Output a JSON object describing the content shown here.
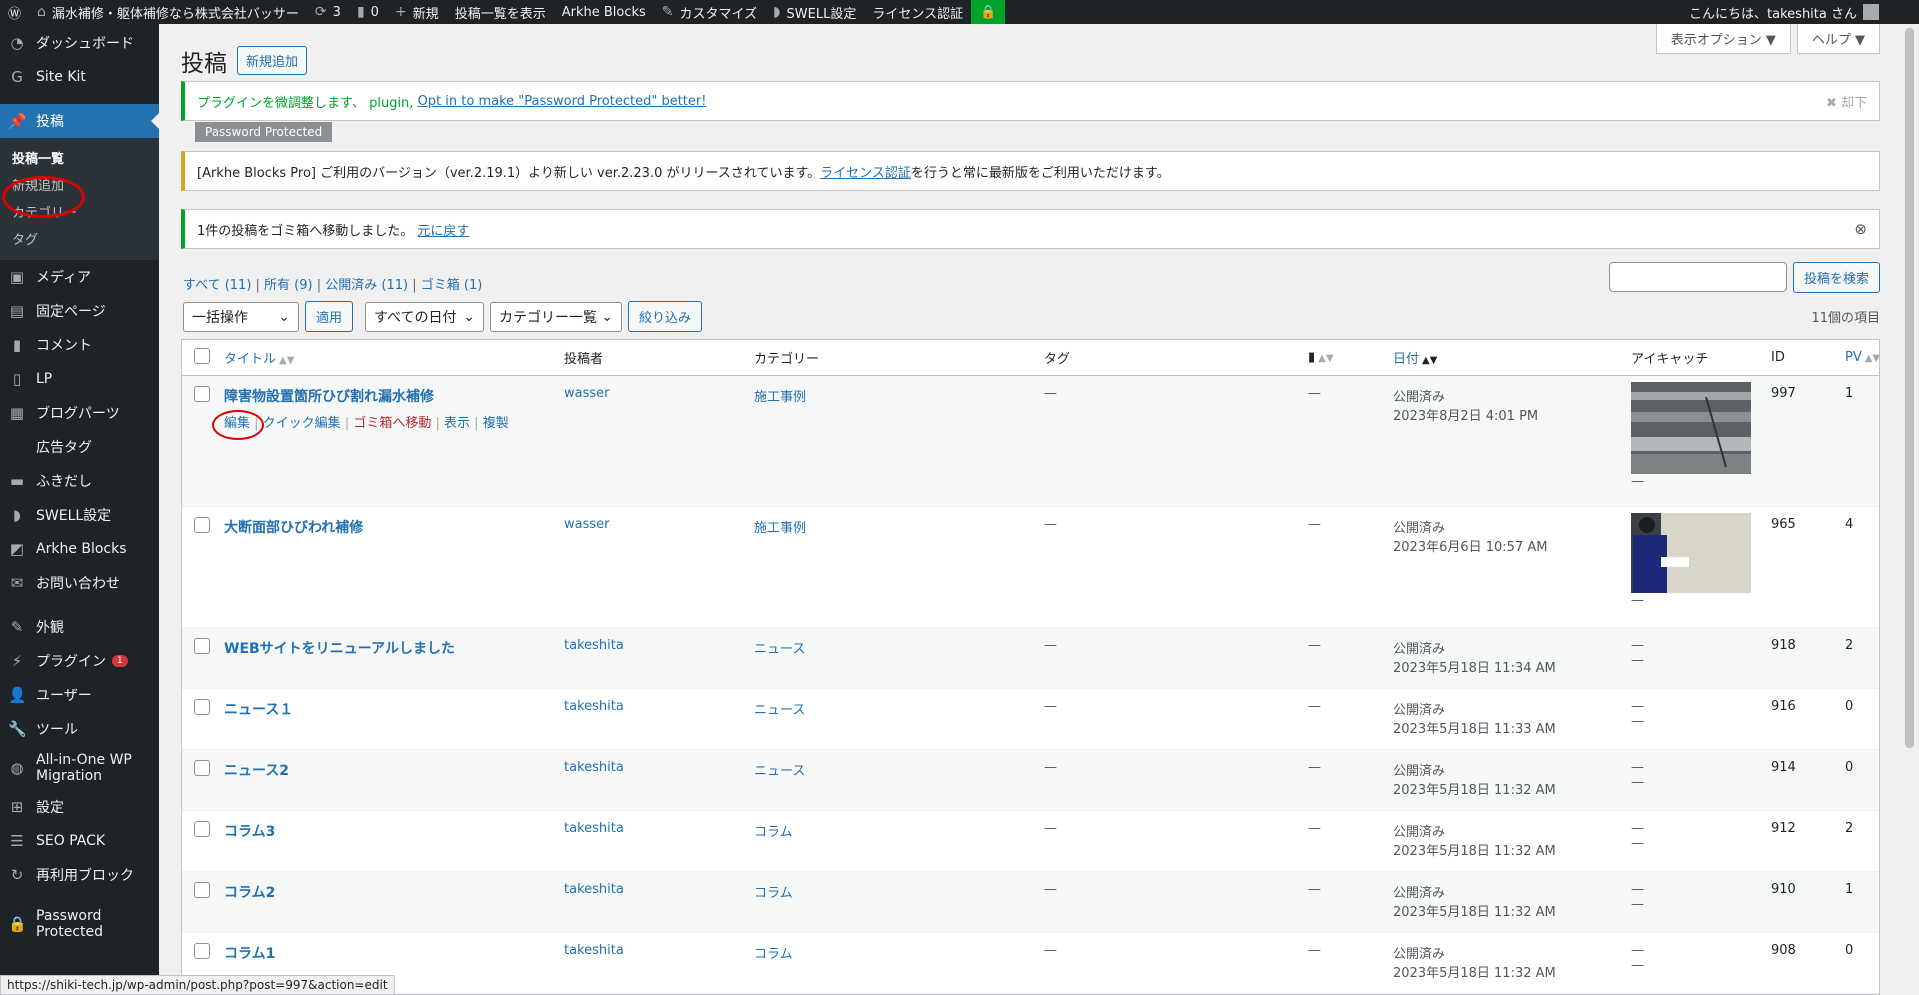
{
  "adminbar": {
    "site_name": "漏水補修・躯体補修なら株式会社バッサー",
    "updates": "3",
    "comments": "0",
    "new": "新規",
    "view_posts": "投稿一覧を表示",
    "arkhe": "Arkhe Blocks",
    "customize": "カスタマイズ",
    "swell": "SWELL設定",
    "license": "ライセンス認証",
    "greeting": "こんにちは、takeshita さん"
  },
  "sidebar": {
    "items": [
      {
        "label": "ダッシュボード"
      },
      {
        "label": "Site Kit"
      },
      {
        "label": "投稿"
      },
      {
        "label": "メディア"
      },
      {
        "label": "固定ページ"
      },
      {
        "label": "コメント"
      },
      {
        "label": "LP"
      },
      {
        "label": "ブログパーツ"
      },
      {
        "label": "広告タグ"
      },
      {
        "label": "ふきだし"
      },
      {
        "label": "SWELL設定"
      },
      {
        "label": "Arkhe Blocks"
      },
      {
        "label": "お問い合わせ"
      },
      {
        "label": "外観"
      },
      {
        "label": "プラグイン"
      },
      {
        "label": "ユーザー"
      },
      {
        "label": "ツール"
      },
      {
        "label": "All-in-One WP Migration"
      },
      {
        "label": "設定"
      },
      {
        "label": "SEO PACK"
      },
      {
        "label": "再利用ブロック"
      },
      {
        "label": "Password Protected"
      }
    ],
    "submenu": [
      "投稿一覧",
      "新規追加",
      "カテゴリー",
      "タグ"
    ],
    "plugin_badge": "1"
  },
  "screen_meta": {
    "options": "表示オプション ▼",
    "help": "ヘルプ ▼"
  },
  "page": {
    "title": "投稿",
    "add_new": "新規追加"
  },
  "notices": {
    "pp_text": "プラグインを微調整します、 plugin,",
    "pp_link": "Opt in to make \"Password Protected\" better!",
    "pp_dismiss": "✖ 却下",
    "pp_tag": "Password Protected",
    "arkhe_text1": "[Arkhe Blocks Pro] ご利用のバージョン（ver.2.19.1）より新しい ver.2.23.0 がリリースされています。",
    "arkhe_link": "ライセンス認証",
    "arkhe_text2": "を行うと常に最新版をご利用いただけます。",
    "trash_text": "1件の投稿をゴミ箱へ移動しました。",
    "trash_link": "元に戻す"
  },
  "filters": {
    "all": "すべて (11)",
    "mine": "所有 (9)",
    "published": "公開済み (11)",
    "trash": "ゴミ箱 (1)",
    "bulk": "一括操作",
    "apply": "適用",
    "dates": "すべての日付",
    "categories": "カテゴリー一覧",
    "filter": "絞り込み",
    "search_btn": "投稿を検索",
    "count": "11個の項目"
  },
  "table": {
    "headers": {
      "title": "タイトル",
      "author": "投稿者",
      "category": "カテゴリー",
      "tag": "タグ",
      "date": "日付",
      "thumb": "アイキャッチ",
      "id": "ID",
      "pv": "PV"
    },
    "row_actions": {
      "edit": "編集",
      "quick": "クイック編集",
      "trash": "ゴミ箱へ移動",
      "view": "表示",
      "copy": "複製"
    },
    "rows": [
      {
        "title": "障害物設置箇所ひび割れ漏水補修",
        "author": "wasser",
        "category": "施工事例",
        "tag": "—",
        "comments": "—",
        "status": "公開済み",
        "date": "2023年8月2日 4:01 PM",
        "id": "997",
        "pv": "1",
        "thumb_dash": "—"
      },
      {
        "title": "大断面部ひびわれ補修",
        "author": "wasser",
        "category": "施工事例",
        "tag": "—",
        "comments": "—",
        "status": "公開済み",
        "date": "2023年6月6日 10:57 AM",
        "id": "965",
        "pv": "4",
        "thumb_dash": "—"
      },
      {
        "title": "WEBサイトをリニューアルしました",
        "author": "takeshita",
        "category": "ニュース",
        "tag": "—",
        "comments": "—",
        "status": "公開済み",
        "date": "2023年5月18日 11:34 AM",
        "id": "918",
        "pv": "2",
        "thumb_dash": "—"
      },
      {
        "title": "ニュース１",
        "author": "takeshita",
        "category": "ニュース",
        "tag": "—",
        "comments": "—",
        "status": "公開済み",
        "date": "2023年5月18日 11:33 AM",
        "id": "916",
        "pv": "0",
        "thumb_dash": "—"
      },
      {
        "title": "ニュース2",
        "author": "takeshita",
        "category": "ニュース",
        "tag": "—",
        "comments": "—",
        "status": "公開済み",
        "date": "2023年5月18日 11:32 AM",
        "id": "914",
        "pv": "0",
        "thumb_dash": "—"
      },
      {
        "title": "コラム3",
        "author": "takeshita",
        "category": "コラム",
        "tag": "—",
        "comments": "—",
        "status": "公開済み",
        "date": "2023年5月18日 11:32 AM",
        "id": "912",
        "pv": "2",
        "thumb_dash": "—"
      },
      {
        "title": "コラム2",
        "author": "takeshita",
        "category": "コラム",
        "tag": "—",
        "comments": "—",
        "status": "公開済み",
        "date": "2023年5月18日 11:32 AM",
        "id": "910",
        "pv": "1",
        "thumb_dash": "—"
      },
      {
        "title": "コラム1",
        "author": "takeshita",
        "category": "コラム",
        "tag": "—",
        "comments": "—",
        "status": "公開済み",
        "date": "2023年5月18日 11:32 AM",
        "id": "908",
        "pv": "0",
        "thumb_dash": "—"
      }
    ]
  },
  "statusbar": "https://shiki-tech.jp/wp-admin/post.php?post=997&action=edit"
}
